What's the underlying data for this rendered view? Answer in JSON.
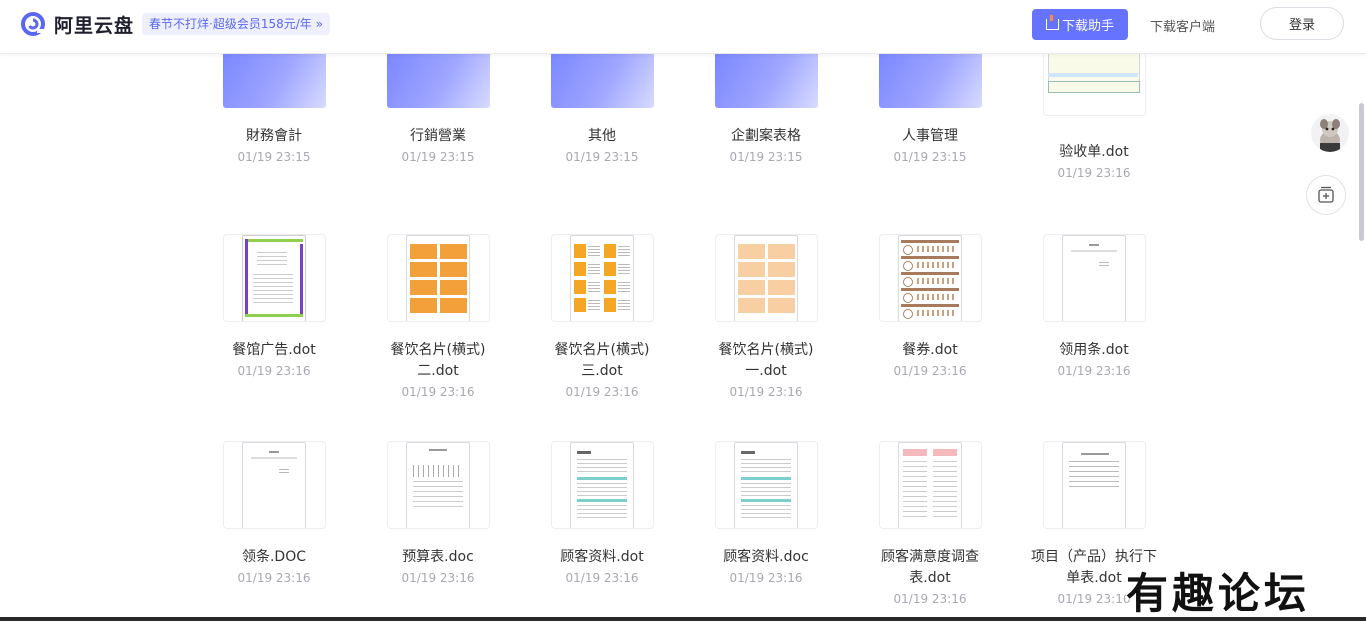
{
  "header": {
    "logo_text": "阿里云盘",
    "promo": "春节不打烊·超级会员158元/年 »",
    "helper_button": "下载助手",
    "client_button": "下载客户端",
    "login_button": "登录"
  },
  "colors": {
    "accent": "#6673ff",
    "folder": "#8d97ff"
  },
  "row1": [
    {
      "name": "財務會計",
      "date": "01/19 23:15",
      "kind": "folder"
    },
    {
      "name": "行銷營業",
      "date": "01/19 23:15",
      "kind": "folder"
    },
    {
      "name": "其他",
      "date": "01/19 23:15",
      "kind": "folder"
    },
    {
      "name": "企劃案表格",
      "date": "01/19 23:15",
      "kind": "folder"
    },
    {
      "name": "人事管理",
      "date": "01/19 23:15",
      "kind": "folder"
    },
    {
      "name": "验收单.dot",
      "date": "01/19 23:16",
      "kind": "form-thumb"
    }
  ],
  "row2": [
    {
      "name": "餐馆广告.dot",
      "date": "01/19 23:16",
      "kind": "ad-thumb"
    },
    {
      "name": "餐饮名片(横式)二.dot",
      "date": "01/19 23:16",
      "kind": "card-orange"
    },
    {
      "name": "餐饮名片(横式)三.dot",
      "date": "01/19 23:16",
      "kind": "card-mixed"
    },
    {
      "name": "餐饮名片(横式)一.dot",
      "date": "01/19 23:16",
      "kind": "card-peach"
    },
    {
      "name": "餐券.dot",
      "date": "01/19 23:16",
      "kind": "coupon-thumb"
    },
    {
      "name": "领用条.dot",
      "date": "01/19 23:16",
      "kind": "blank-thumb"
    }
  ],
  "row3": [
    {
      "name": "领条.DOC",
      "date": "01/19 23:16",
      "kind": "blank-thumb"
    },
    {
      "name": "预算表.doc",
      "date": "01/19 23:16",
      "kind": "table-thumb"
    },
    {
      "name": "顾客资料.dot",
      "date": "01/19 23:16",
      "kind": "customer-thumb"
    },
    {
      "name": "顾客资料.doc",
      "date": "01/19 23:16",
      "kind": "customer-thumb"
    },
    {
      "name": "顾客满意度调查表.dot",
      "date": "01/19 23:16",
      "kind": "survey-thumb"
    },
    {
      "name": "项目（产品）执行下单表.dot",
      "date": "01/19 23:16",
      "kind": "text-thumb"
    }
  ],
  "watermark": "有趣论坛"
}
